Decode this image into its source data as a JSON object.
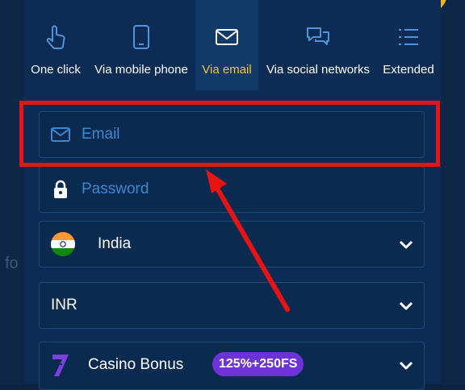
{
  "tabs": [
    {
      "label": "One click",
      "icon": "hand-pointer-icon"
    },
    {
      "label": "Via mobile phone",
      "icon": "mobile-phone-icon"
    },
    {
      "label": "Via email",
      "icon": "envelope-icon",
      "active": true
    },
    {
      "label": "Via social networks",
      "icon": "chat-bubbles-icon"
    },
    {
      "label": "Extended",
      "icon": "list-icon"
    }
  ],
  "form": {
    "email_placeholder": "Email",
    "password_placeholder": "Password",
    "country": "India",
    "currency": "INR",
    "bonus_label": "Casino Bonus",
    "bonus_badge": "125%+250FS"
  },
  "background": {
    "partial_text": "fo"
  },
  "colors": {
    "panel": "#0c2c55",
    "active_tab_text": "#f6c432",
    "placeholder": "#3d87d1",
    "highlight": "#e81313",
    "badge": "#6d32d8"
  }
}
